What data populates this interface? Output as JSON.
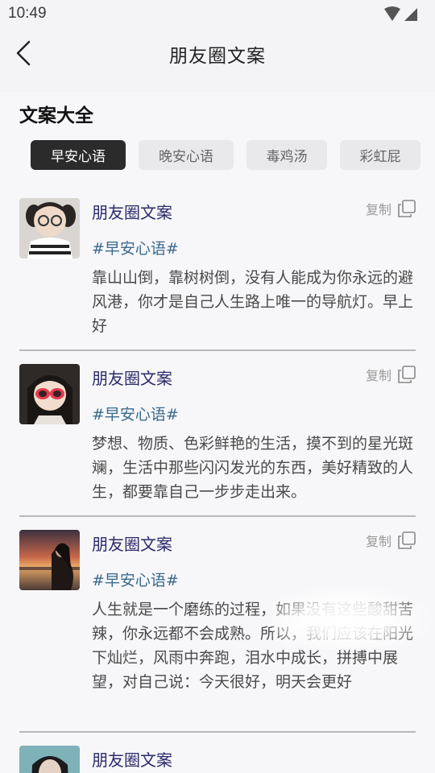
{
  "status_bar": {
    "time": "10:49",
    "icons": [
      "wifi-icon",
      "signal-icon"
    ]
  },
  "header": {
    "title": "朋友圈文案",
    "back_icon": "chevron-left-icon"
  },
  "section": {
    "title": "文案大全"
  },
  "tabs": [
    {
      "label": "早安心语",
      "active": true
    },
    {
      "label": "晚安心语",
      "active": false
    },
    {
      "label": "毒鸡汤",
      "active": false
    },
    {
      "label": "彩虹屁",
      "active": false
    }
  ],
  "posts": [
    {
      "author": "朋友圈文案",
      "copy_label": "复制",
      "hashtag": "#早安心语#",
      "text": "靠山山倒，靠树树倒，没有人能成为你永远的避风港，你才是自己人生路上唯一的导航灯。早上好"
    },
    {
      "author": "朋友圈文案",
      "copy_label": "复制",
      "hashtag": "#早安心语#",
      "text": "梦想、物质、色彩鲜艳的生活，摸不到的星光斑斓，生活中那些闪闪发光的东西，美好精致的人生，都要靠自己一步步走出来。"
    },
    {
      "author": "朋友圈文案",
      "copy_label": "复制",
      "hashtag": "#早安心语#",
      "text": "人生就是一个磨练的过程，如果没有这些酸甜苦辣，你永远都不会成熟。所以，我们应该在阳光下灿烂，风雨中奔跑，泪水中成长，拼搏中展望，对自己说：今天很好，明天会更好"
    },
    {
      "author": "朋友圈文案"
    }
  ],
  "colors": {
    "accent_dark": "#2b2b2b",
    "author": "#2b2a6b",
    "hashtag": "#3a6a8e",
    "background": "#f7f7f9"
  }
}
